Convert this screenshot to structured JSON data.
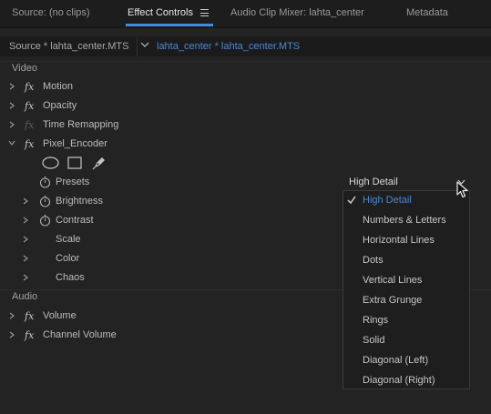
{
  "tabs": [
    {
      "label": "Source: (no clips)"
    },
    {
      "label": "Effect Controls"
    },
    {
      "label": "Audio Clip Mixer: lahta_center"
    },
    {
      "label": "Metadata"
    }
  ],
  "clip": {
    "source": "Source * lahta_center.MTS",
    "sequence": "lahta_center * lahta_center.MTS"
  },
  "sections": {
    "video": "Video",
    "audio": "Audio"
  },
  "video_effects": {
    "motion": "Motion",
    "opacity": "Opacity",
    "time_remapping": "Time Remapping",
    "pixel_encoder": "Pixel_Encoder"
  },
  "pixel_encoder_params": {
    "presets": "Presets",
    "brightness": "Brightness",
    "contrast": "Contrast",
    "scale": "Scale",
    "color": "Color",
    "chaos": "Chaos"
  },
  "audio_effects": {
    "volume": "Volume",
    "channel_volume": "Channel Volume"
  },
  "fx_symbol": "fx",
  "preset_dropdown": {
    "selected": "High Detail",
    "options": [
      "High Detail",
      "Numbers & Letters",
      "Horizontal Lines",
      "Dots",
      "Vertical Lines",
      "Extra Grunge",
      "Rings",
      "Solid",
      "Diagonal (Left)",
      "Diagonal (Right)"
    ]
  },
  "colors": {
    "accent": "#4a88d8",
    "background": "#232323"
  }
}
